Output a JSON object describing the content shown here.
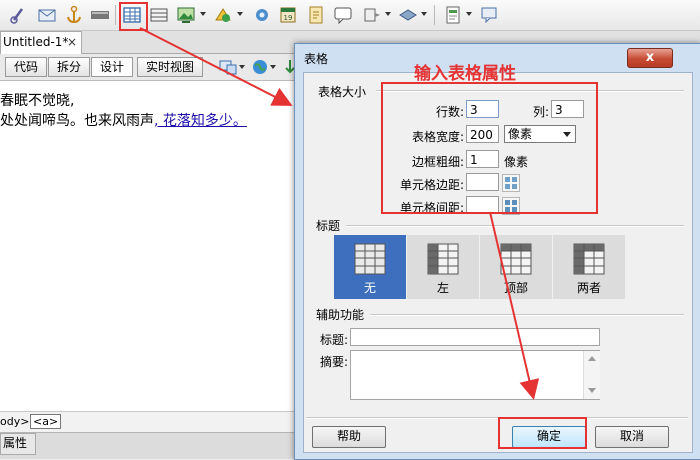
{
  "document": {
    "tab_title": "Untitled-1*",
    "tab_close": "×",
    "view_buttons": [
      "代码",
      "拆分",
      "设计",
      "实时视图"
    ],
    "poem_line_1": "春眠不觉晓,",
    "poem_line_2_plain": "处处闻啼鸟。也来风雨声",
    "poem_line_2_link": ", 花落知多少。"
  },
  "status_bar": {
    "tag_path": "ody>",
    "tag": "<a>"
  },
  "properties_panel": {
    "label": "属性"
  },
  "dialog": {
    "title": "表格",
    "close": "x",
    "size_section": "表格大小",
    "rows_label": "行数:",
    "rows_value": "3",
    "cols_label": "列:",
    "cols_value": "3",
    "width_label": "表格宽度:",
    "width_value": "200",
    "width_unit": "像素",
    "border_label": "边框粗细:",
    "border_value": "1",
    "border_unit": "像素",
    "padding_label": "单元格边距:",
    "padding_value": "",
    "spacing_label": "单元格间距:",
    "spacing_value": "",
    "header_section": "标题",
    "header_options": [
      "无",
      "左",
      "顶部",
      "两者"
    ],
    "header_selected": "无",
    "accessibility_section": "辅助功能",
    "caption_label": "标题:",
    "caption_value": "",
    "summary_label": "摘要:",
    "summary_value": "",
    "help_button": "帮助",
    "ok_button": "确定",
    "cancel_button": "取消"
  },
  "annotation": {
    "text": "输入表格属性",
    "color": "#e53333"
  },
  "colors": {
    "selected_header": "#3e6fbf",
    "dialog_frame": "#cfe0f3"
  }
}
